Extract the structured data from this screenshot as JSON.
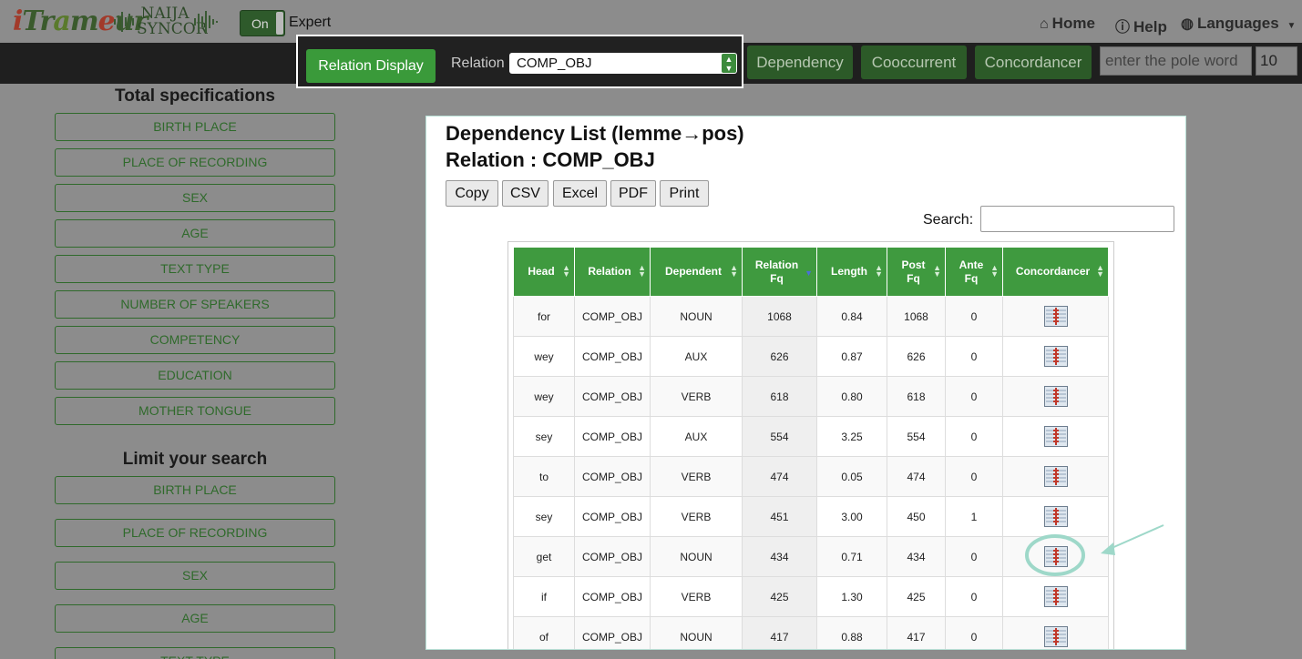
{
  "brand": {
    "logo_text": "iTrameur",
    "logo2_text": "NAIJA SYNCOR"
  },
  "topbar": {
    "toggle_label": "On",
    "expert_label": "Expert",
    "home": "Home",
    "help": "Help",
    "languages": "Languages"
  },
  "toolbar": {
    "dependency": "Dependency",
    "cooccurrent": "Cooccurrent",
    "concordancer": "Concordancer",
    "pole_placeholder": "enter the pole word",
    "pole_count": "10"
  },
  "relation_popup": {
    "button": "Relation Display",
    "label": "Relation",
    "selected": "COMP_OBJ"
  },
  "sidebar": {
    "total_title": "Total specifications",
    "total_items": [
      "BIRTH PLACE",
      "PLACE OF RECORDING",
      "SEX",
      "AGE",
      "TEXT TYPE",
      "NUMBER OF SPEAKERS",
      "COMPETENCY",
      "EDUCATION",
      "MOTHER TONGUE"
    ],
    "limit_title": "Limit your search",
    "limit_items": [
      "BIRTH PLACE",
      "PLACE OF RECORDING",
      "SEX",
      "AGE",
      "TEXT TYPE"
    ]
  },
  "panel": {
    "title1": "Dependency List (lemme→pos)",
    "title2": "Relation : COMP_OBJ",
    "export_buttons": [
      "Copy",
      "CSV",
      "Excel",
      "PDF",
      "Print"
    ],
    "search_label": "Search:",
    "search_value": "",
    "columns": [
      "Head",
      "Relation",
      "Dependent",
      "Relation Fq",
      "Length",
      "Post Fq",
      "Ante Fq",
      "Concordancer"
    ],
    "rows": [
      [
        "for",
        "COMP_OBJ",
        "NOUN",
        "1068",
        "0.84",
        "1068",
        "0"
      ],
      [
        "wey",
        "COMP_OBJ",
        "AUX",
        "626",
        "0.87",
        "626",
        "0"
      ],
      [
        "wey",
        "COMP_OBJ",
        "VERB",
        "618",
        "0.80",
        "618",
        "0"
      ],
      [
        "sey",
        "COMP_OBJ",
        "AUX",
        "554",
        "3.25",
        "554",
        "0"
      ],
      [
        "to",
        "COMP_OBJ",
        "VERB",
        "474",
        "0.05",
        "474",
        "0"
      ],
      [
        "sey",
        "COMP_OBJ",
        "VERB",
        "451",
        "3.00",
        "450",
        "1"
      ],
      [
        "get",
        "COMP_OBJ",
        "NOUN",
        "434",
        "0.71",
        "434",
        "0"
      ],
      [
        "if",
        "COMP_OBJ",
        "VERB",
        "425",
        "1.30",
        "425",
        "0"
      ],
      [
        "of",
        "COMP_OBJ",
        "NOUN",
        "417",
        "0.88",
        "417",
        "0"
      ]
    ]
  },
  "icons": {
    "home": "home-icon",
    "help": "help-icon",
    "languages": "globe-icon",
    "concordancer": "concordancer-icon"
  },
  "colors": {
    "green": "#3f9a3f",
    "dark_green": "#2c5a28",
    "annotation": "#9ed8c9"
  }
}
